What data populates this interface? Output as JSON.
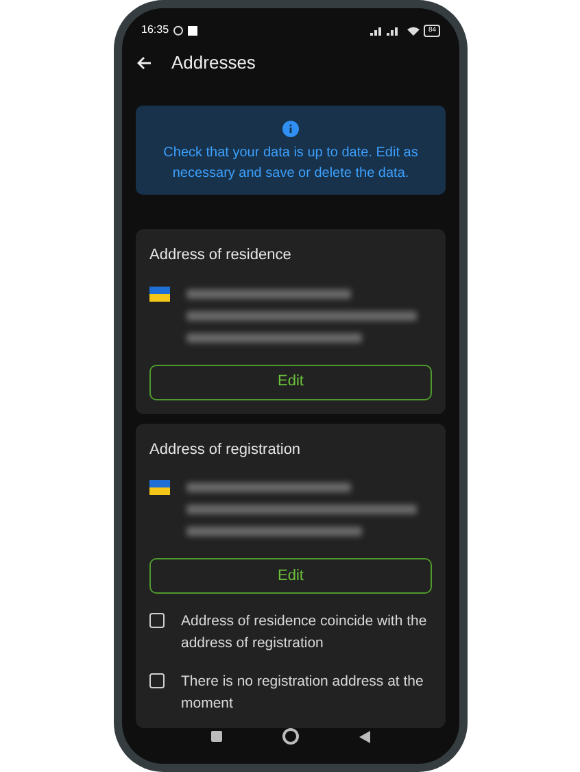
{
  "status_bar": {
    "time": "16:35",
    "battery": "84"
  },
  "header": {
    "title": "Addresses"
  },
  "notice": {
    "text": "Check that your data is up to date. Edit as necessary and save or delete the data."
  },
  "cards": [
    {
      "title": "Address of residence",
      "address_hidden": true,
      "edit_button": "Edit"
    },
    {
      "title": "Address of registration",
      "address_hidden": true,
      "edit_button": "Edit",
      "options": [
        {
          "label": "Address of residence coincide with the address of registration",
          "checked": false
        },
        {
          "label": "There is no registration address at the moment",
          "checked": false
        }
      ]
    }
  ]
}
